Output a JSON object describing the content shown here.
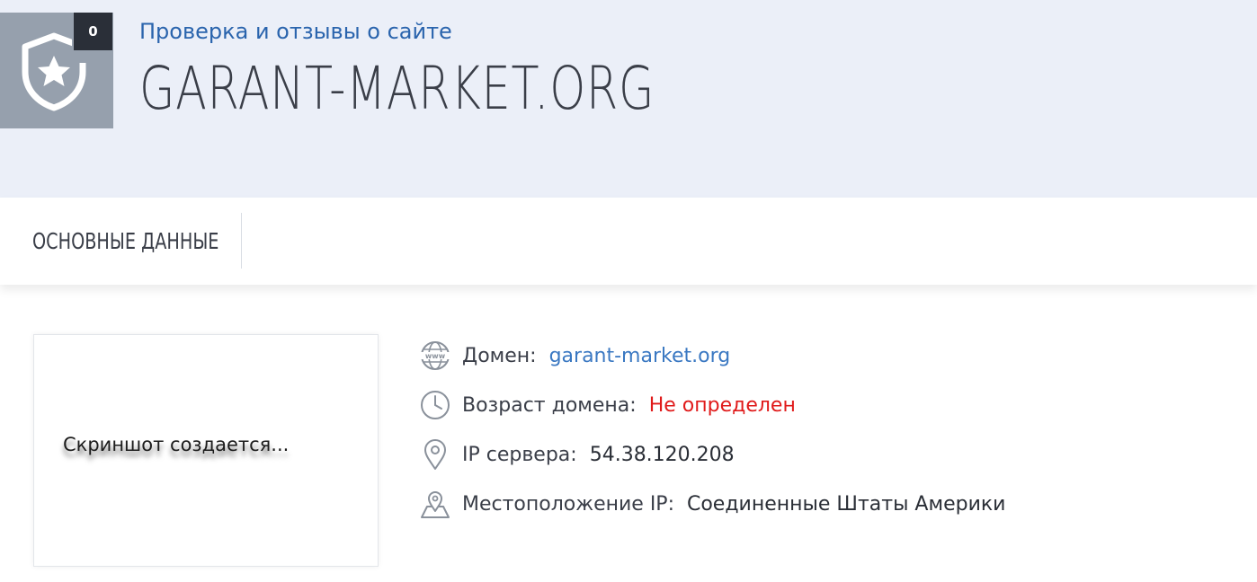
{
  "header": {
    "badge_count": "0",
    "subtitle": "Проверка и отзывы о сайте",
    "site_title": "GARANT-MARKET.ORG"
  },
  "tabs": [
    {
      "label": "ОСНОВНЫЕ ДАННЫЕ"
    }
  ],
  "screenshot_placeholder": {
    "text": "Скриншот создается..."
  },
  "info": {
    "domain": {
      "icon": "www-globe-icon",
      "label": "Домен:",
      "value": "garant-market.org"
    },
    "age": {
      "icon": "clock-icon",
      "label": "Возраст домена:",
      "value": "Не определен"
    },
    "ip": {
      "icon": "location-pin-icon",
      "label": "IP сервера:",
      "value": "54.38.120.208"
    },
    "location": {
      "icon": "map-pin-icon",
      "label": "Местоположение IP:",
      "value": "Соединенные Штаты Америки"
    }
  },
  "colors": {
    "header_bg": "#ebeff8",
    "subtitle": "#2a64ad",
    "link": "#3a78c2",
    "warning": "#e01a1a",
    "shield_box": "#96a0ad",
    "badge_bg": "#2a2f38"
  }
}
